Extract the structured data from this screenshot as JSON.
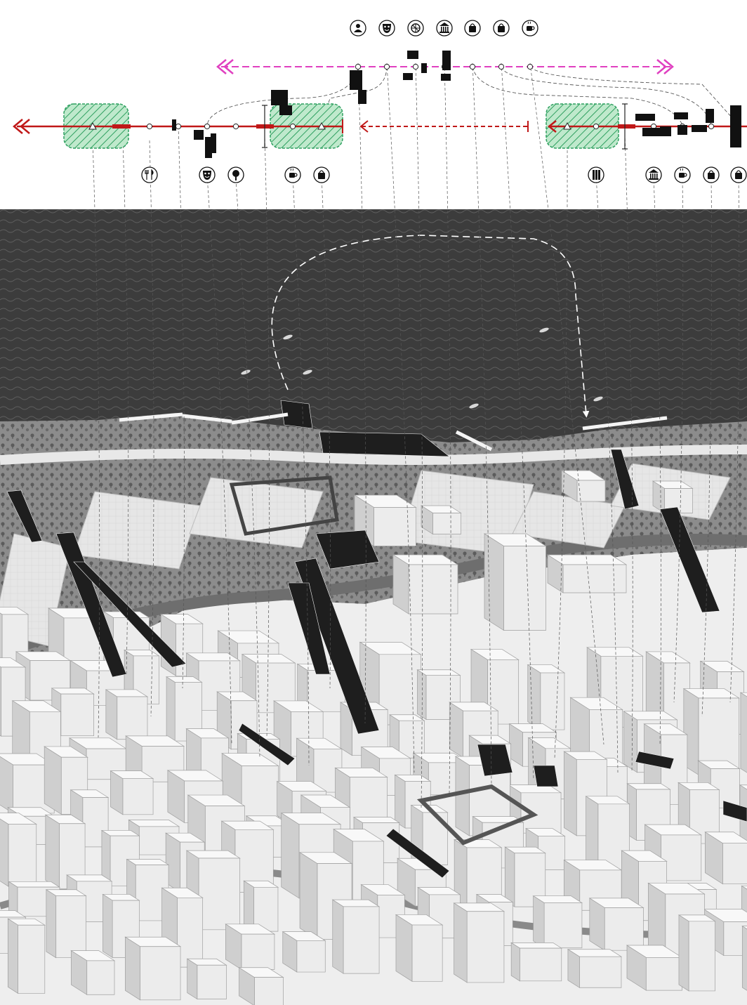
{
  "colors": {
    "background": "#ffffff",
    "water": "#3c3c3c",
    "water_wave": "#5a5a5a",
    "shore_green": "#8a8a8a",
    "tree_zone": "#777777",
    "urban_ground": "#f0f0f0",
    "building_top": "#f7f7f7",
    "building_side": "#d2d2d2",
    "building_outline": "#9a9a9a",
    "road": "#6e6e6e",
    "infrastructure": "#1c1c1c",
    "route_red": "#c01818",
    "route_magenta": "#e040c0",
    "park_green": "#2fa060",
    "park_fill": "#9fdcb4",
    "icon_stroke": "#111111",
    "leader_line": "#555555"
  },
  "legend_top_row": {
    "icons": [
      "tourist-guide-icon",
      "theatre-mask-icon",
      "sports-ball-icon",
      "museum-icon",
      "shopping-bag-icon",
      "shopping-bag-icon",
      "coffee-cup-icon"
    ]
  },
  "legend_bottom_row_left": {
    "icons": [
      "restaurant-icon",
      "theatre-mask-icon",
      "park-tree-icon",
      "coffee-cup-icon",
      "shopping-bag-icon"
    ]
  },
  "legend_bottom_row_right": {
    "icons": [
      "library-books-icon",
      "museum-icon",
      "coffee-cup-icon",
      "shopping-bag-icon",
      "shopping-bag-icon"
    ]
  }
}
